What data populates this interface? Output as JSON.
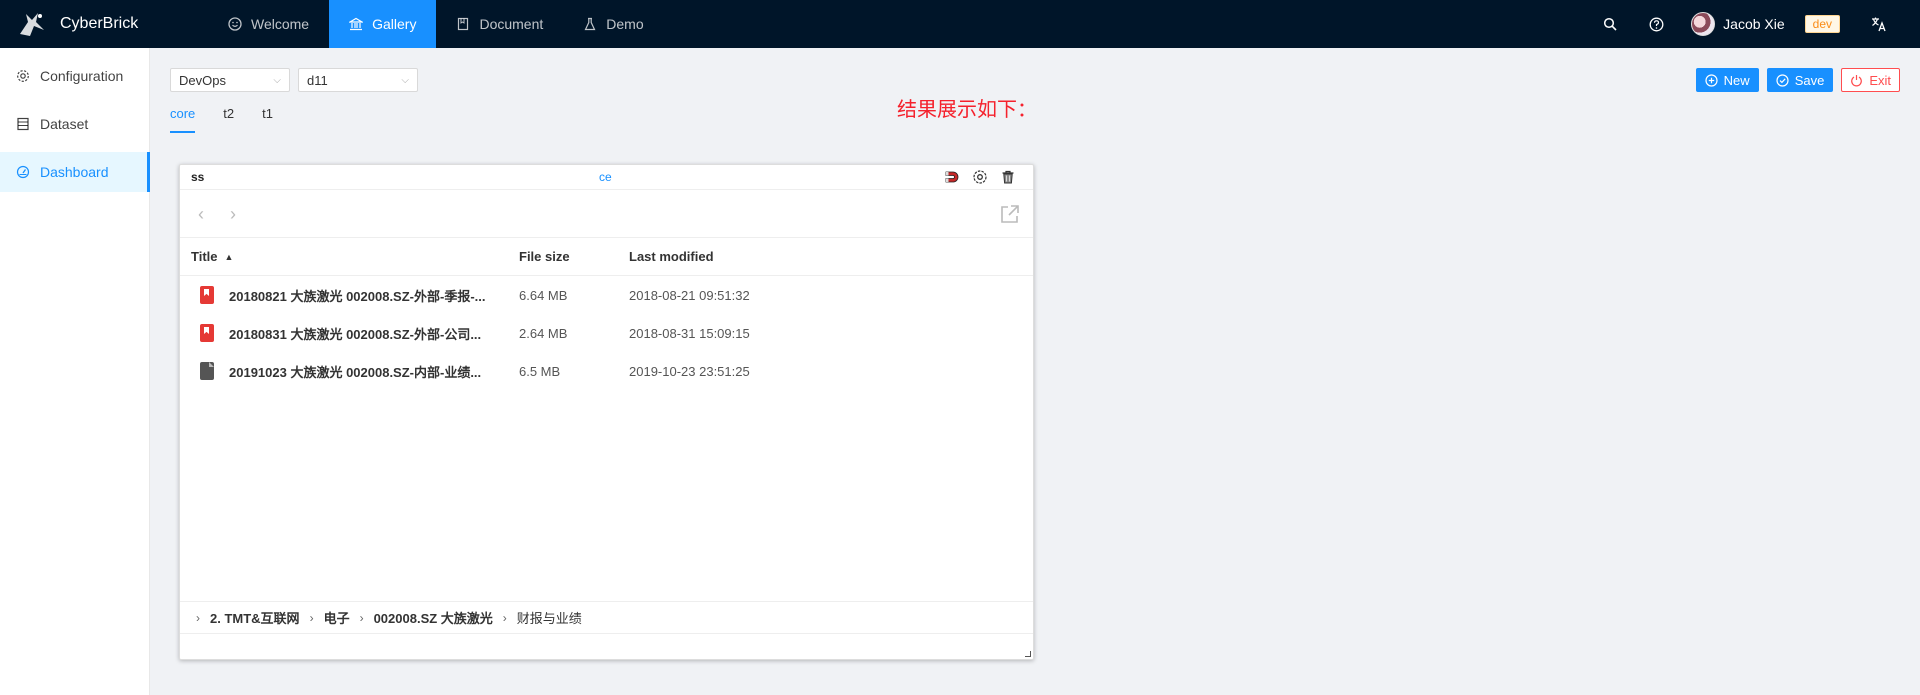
{
  "app": {
    "name": "CyberBrick"
  },
  "topnav": [
    {
      "label": "Welcome",
      "icon": "smile-icon"
    },
    {
      "label": "Gallery",
      "icon": "bank-icon",
      "active": true
    },
    {
      "label": "Document",
      "icon": "book-icon"
    },
    {
      "label": "Demo",
      "icon": "flask-icon"
    }
  ],
  "user": {
    "name": "Jacob Xie",
    "env": "dev"
  },
  "sidebar": [
    {
      "label": "Configuration",
      "icon": "gear-icon"
    },
    {
      "label": "Dataset",
      "icon": "database-icon"
    },
    {
      "label": "Dashboard",
      "icon": "dashboard-icon",
      "active": true
    }
  ],
  "selects": {
    "category": "DevOps",
    "dashboard": "d11"
  },
  "tabs": [
    "core",
    "t2",
    "t1"
  ],
  "note": "结果展示如下：",
  "actions": {
    "new": "New",
    "save": "Save",
    "exit": "Exit"
  },
  "panel": {
    "title": "ss",
    "center_label": "ce",
    "table": {
      "headers": {
        "title": "Title",
        "size": "File size",
        "modified": "Last modified"
      },
      "rows": [
        {
          "title": "20180821 大族激光 002008.SZ-外部-季报-...",
          "size": "6.64 MB",
          "modified": "2018-08-21 09:51:32",
          "type": "pdf"
        },
        {
          "title": "20180831 大族激光 002008.SZ-外部-公司...",
          "size": "2.64 MB",
          "modified": "2018-08-31 15:09:15",
          "type": "pdf"
        },
        {
          "title": "20191023 大族激光 002008.SZ-内部-业绩...",
          "size": "6.5 MB",
          "modified": "2019-10-23 23:51:25",
          "type": "doc"
        }
      ]
    },
    "breadcrumb": [
      "2. TMT&互联网",
      "电子",
      "002008.SZ 大族激光",
      "财报与业绩"
    ]
  },
  "colors": {
    "primary": "#1890ff",
    "header_bg": "#001529",
    "danger": "#ff4d4f",
    "note": "#f5222d"
  }
}
